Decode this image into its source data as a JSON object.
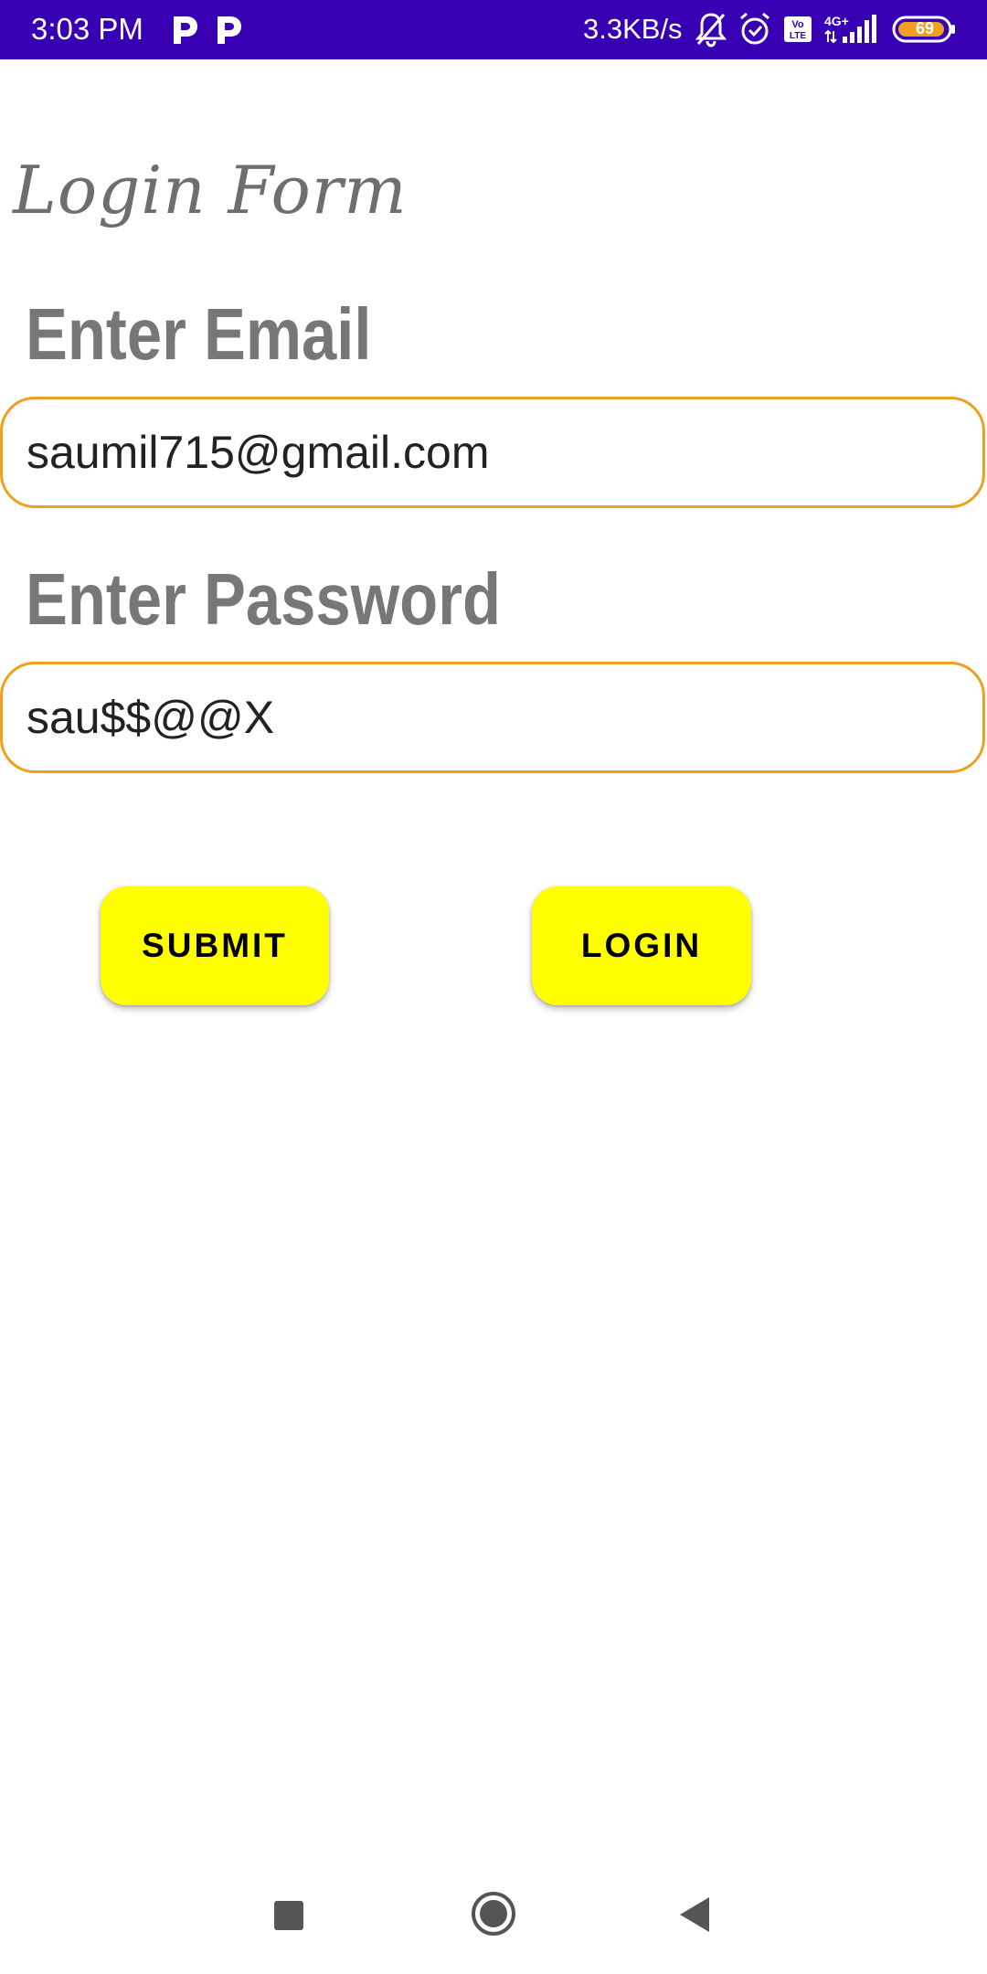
{
  "status_bar": {
    "time": "3:03 PM",
    "network_speed": "3.3KB/s",
    "battery_level": "69",
    "background_color": "#3700b3",
    "icons": [
      "parking-notification-icon",
      "parking-notification-icon",
      "bell-muted-icon",
      "alarm-icon",
      "volte-icon",
      "signal-4g-icon",
      "battery-icon"
    ]
  },
  "form": {
    "title": "Login Form",
    "email_label": "Enter Email",
    "email_value": "saumil715@gmail.com",
    "password_label": "Enter Password",
    "password_value": "sau$$@@X",
    "field_border_color": "#f0a020"
  },
  "buttons": {
    "submit_label": "SUBMIT",
    "login_label": "LOGIN",
    "color": "#ffff00"
  },
  "nav_bar": {
    "icons": [
      "recents-square-icon",
      "home-circle-icon",
      "back-triangle-icon"
    ]
  }
}
